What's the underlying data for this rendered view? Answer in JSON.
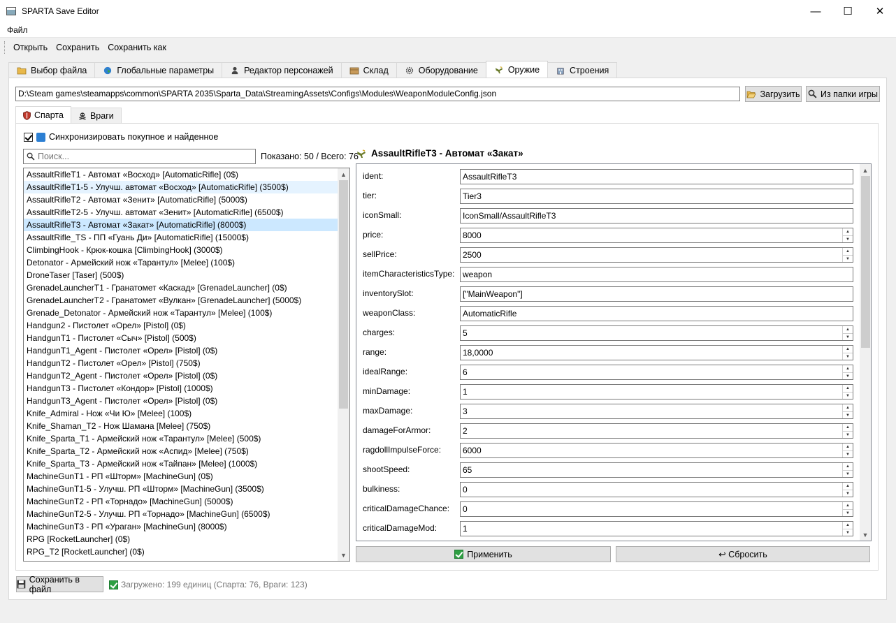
{
  "window": {
    "title": "SPARTA Save Editor",
    "minimize": "—",
    "maximize": "☐",
    "close": "✕"
  },
  "menu": {
    "items": [
      "Файл"
    ]
  },
  "toolbar": {
    "open": "Открыть",
    "save": "Сохранить",
    "save_as": "Сохранить как"
  },
  "main_tabs": [
    {
      "label": "Выбор файла",
      "icon": "folder-icon"
    },
    {
      "label": "Глобальные параметры",
      "icon": "globe-icon"
    },
    {
      "label": "Редактор персонажей",
      "icon": "person-icon"
    },
    {
      "label": "Склад",
      "icon": "box-icon"
    },
    {
      "label": "Оборудование",
      "icon": "gear-icon"
    },
    {
      "label": "Оружие",
      "icon": "weapon-icon",
      "active": true
    },
    {
      "label": "Строения",
      "icon": "building-icon"
    }
  ],
  "path": {
    "value": "D:\\Steam games\\steamapps\\common\\SPARTA 2035\\Sparta_Data\\StreamingAssets\\Configs\\Modules\\WeaponModuleConfig.json",
    "load_button": "Загрузить",
    "from_game_button": "Из папки игры"
  },
  "sub_tabs": [
    {
      "label": "Спарта",
      "active": true
    },
    {
      "label": "Враги"
    }
  ],
  "sync": {
    "label": "Синхронизировать покупное и найденное",
    "checked": true
  },
  "search": {
    "placeholder": "Поиск...",
    "count": "Показано: 50 / Всего: 76"
  },
  "items": [
    "AssaultRifleT1 - Автомат «Восход»  [AutomaticRifle]  (0$)",
    "AssaultRifleT1-5 - Улучш. автомат «Восход»  [AutomaticRifle]  (3500$)",
    "AssaultRifleT2 - Автомат «Зенит»  [AutomaticRifle]  (5000$)",
    "AssaultRifleT2-5 - Улучш. автомат «Зенит»  [AutomaticRifle]  (6500$)",
    "AssaultRifleT3 - Автомат «Закат»  [AutomaticRifle]  (8000$)",
    "AssaultRifle_TS - ПП «Гуань Ди»  [AutomaticRifle]  (15000$)",
    "ClimbingHook - Крюк-кошка  [ClimbingHook]  (3000$)",
    "Detonator - Армейский нож «Тарантул»  [Melee]  (100$)",
    "DroneTaser  [Taser]  (500$)",
    "GrenadeLauncherT1 - Гранатомет «Каскад»  [GrenadeLauncher]  (0$)",
    "GrenadeLauncherT2 - Гранатомет «Вулкан»  [GrenadeLauncher]  (5000$)",
    "Grenade_Detonator - Армейский нож «Тарантул»  [Melee]  (100$)",
    "Handgun2 - Пистолет «Орел»  [Pistol]  (0$)",
    "HandgunT1 - Пистолет «Сыч»  [Pistol]  (500$)",
    "HandgunT1_Agent - Пистолет «Орел»  [Pistol]  (0$)",
    "HandgunT2 - Пистолет «Орел»  [Pistol]  (750$)",
    "HandgunT2_Agent - Пистолет «Орел»  [Pistol]  (0$)",
    "HandgunT3 - Пистолет «Кондор»  [Pistol]  (1000$)",
    "HandgunT3_Agent - Пистолет «Орел»  [Pistol]  (0$)",
    "Knife_Admiral - Нож «Чи Ю»  [Melee]  (100$)",
    "Knife_Shaman_T2 - Нож Шамана  [Melee]  (750$)",
    "Knife_Sparta_T1 - Армейский нож «Тарантул»  [Melee]  (500$)",
    "Knife_Sparta_T2 - Армейский нож «Аспид»  [Melee]  (750$)",
    "Knife_Sparta_T3 - Армейский нож «Тайпан»  [Melee]  (1000$)",
    "MachineGunT1 - РП «Шторм»  [MachineGun]  (0$)",
    "MachineGunT1-5 - Улучш. РП «Шторм»  [MachineGun]  (3500$)",
    "MachineGunT2 - РП «Торнадо»  [MachineGun]  (5000$)",
    "MachineGunT2-5 - Улучш. РП «Торнадо»  [MachineGun]  (6500$)",
    "MachineGunT3 - РП «Ураган»  [MachineGun]  (8000$)",
    "RPG  [RocketLauncher]  (0$)",
    "RPG_T2  [RocketLauncher]  (0$)"
  ],
  "list_state": {
    "hover_index": 1,
    "selected_index": 4,
    "scroll_thumb_fraction": 0.62
  },
  "detail": {
    "title": "AssaultRifleT3 - Автомат «Закат»",
    "fields": [
      {
        "label": "ident:",
        "value": "AssaultRifleT3",
        "spin": false
      },
      {
        "label": "tier:",
        "value": "Tier3",
        "spin": false
      },
      {
        "label": "iconSmall:",
        "value": "IconSmall/AssaultRifleT3",
        "spin": false
      },
      {
        "label": "price:",
        "value": "8000",
        "spin": true
      },
      {
        "label": "sellPrice:",
        "value": "2500",
        "spin": true
      },
      {
        "label": "itemCharacteristicsType:",
        "value": "weapon",
        "spin": false
      },
      {
        "label": "inventorySlot:",
        "value": "[\"MainWeapon\"]",
        "spin": false
      },
      {
        "label": "weaponClass:",
        "value": "AutomaticRifle",
        "spin": false
      },
      {
        "label": "charges:",
        "value": "5",
        "spin": true
      },
      {
        "label": "range:",
        "value": "18,0000",
        "spin": true
      },
      {
        "label": "idealRange:",
        "value": "6",
        "spin": true
      },
      {
        "label": "minDamage:",
        "value": "1",
        "spin": true
      },
      {
        "label": "maxDamage:",
        "value": "3",
        "spin": true
      },
      {
        "label": "damageForArmor:",
        "value": "2",
        "spin": true
      },
      {
        "label": "ragdollImpulseForce:",
        "value": "6000",
        "spin": true
      },
      {
        "label": "shootSpeed:",
        "value": "65",
        "spin": true
      },
      {
        "label": "bulkiness:",
        "value": "0",
        "spin": true
      },
      {
        "label": "criticalDamageChance:",
        "value": "0",
        "spin": true
      },
      {
        "label": "criticalDamageMod:",
        "value": "1",
        "spin": true
      }
    ],
    "apply_button": "Применить",
    "reset_button": "↩ Сбросить"
  },
  "footer": {
    "save_button": "Сохранить в файл",
    "status": "Загружено: 199 единиц (Спарта: 76, Враги: 123)"
  }
}
